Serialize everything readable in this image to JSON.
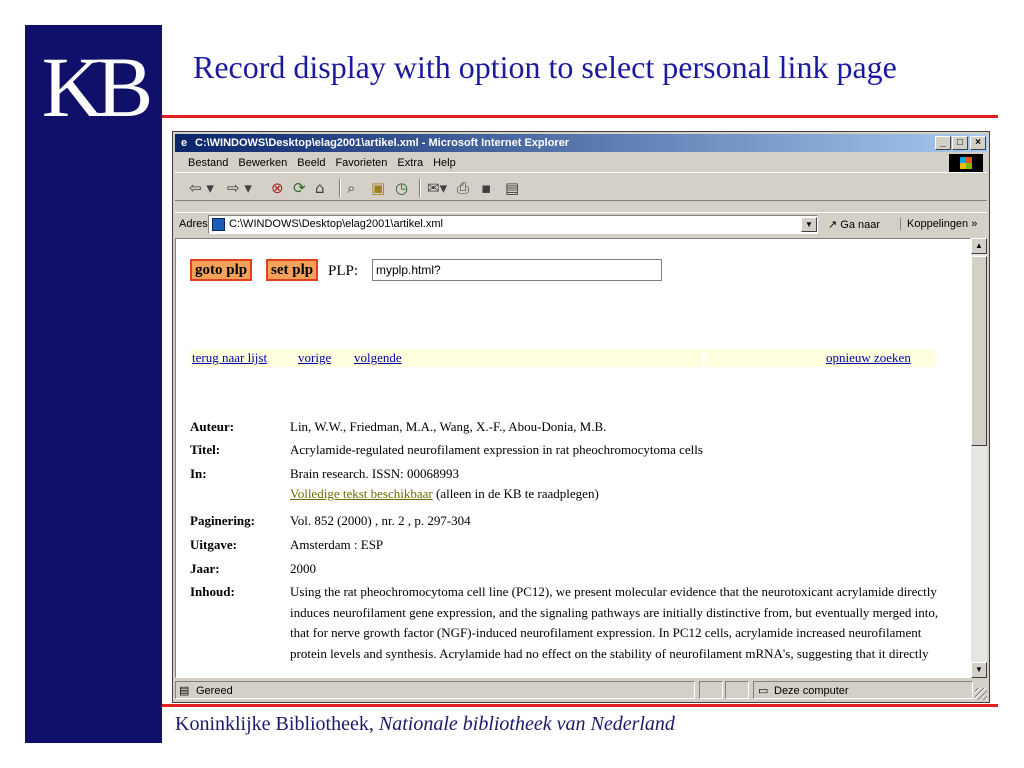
{
  "slide": {
    "logo": "KB",
    "title": "Record display with option to select personal link page",
    "footer_plain": "Koninklijke Bibliotheek, ",
    "footer_italic": "Nationale bibliotheek van Nederland"
  },
  "window": {
    "title": "C:\\WINDOWS\\Desktop\\elag2001\\artikel.xml - Microsoft Internet Explorer",
    "controls": {
      "minimize": "_",
      "maximize": "□",
      "close": "×"
    }
  },
  "menu": [
    "Bestand",
    "Bewerken",
    "Beeld",
    "Favorieten",
    "Extra",
    "Help"
  ],
  "toolbar_icons": [
    "back-arrow-icon",
    "forward-arrow-icon",
    "stop-icon",
    "refresh-icon",
    "home-icon",
    "search-icon",
    "favorites-icon",
    "history-icon",
    "mail-icon",
    "print-icon",
    "edit-icon",
    "discuss-icon"
  ],
  "address": {
    "label": "Adres",
    "value": "C:\\WINDOWS\\Desktop\\elag2001\\artikel.xml",
    "go": "Ga naar",
    "links": "Koppelingen »"
  },
  "plp": {
    "goto_label": "goto plp",
    "set_label": "set plp",
    "field_label": "PLP:",
    "field_value": "myplp.html?"
  },
  "nav": {
    "back_to_list": "terug naar lijst",
    "previous": "vorige",
    "next": "volgende",
    "new_search": "opnieuw zoeken"
  },
  "record": {
    "author_label": "Auteur:",
    "author": "Lin, W.W., Friedman, M.A., Wang, X.-F., Abou-Donia, M.B.",
    "title_label": "Titel:",
    "title": "Acrylamide-regulated neurofilament expression in rat pheochromocytoma cells",
    "in_label": "In:",
    "in_line1": "Brain research. ISSN: 00068993",
    "fulltext_link": "Volledige tekst beschikbaar",
    "fulltext_note": " (alleen in de KB te raadplegen)",
    "pages_label": "Paginering:",
    "pages": "Vol. 852 (2000) , nr. 2 , p. 297-304",
    "publisher_label": "Uitgave:",
    "publisher": "Amsterdam : ESP",
    "year_label": "Jaar:",
    "year": "2000",
    "abstract_label": "Inhoud:",
    "abstract": "Using the rat pheochromocytoma cell line (PC12), we present molecular evidence that the neurotoxicant acrylamide directly induces neurofilament gene expression, and the signaling pathways are initially distinctive from, but eventually merged into, that for nerve growth factor (NGF)-induced neurofilament expression. In PC12 cells, acrylamide increased neurofilament protein levels and synthesis. Acrylamide had no effect on the stability of neurofilament mRNA's, suggesting that it directly"
  },
  "status": {
    "text": "Gereed",
    "zone": "Deze computer"
  }
}
